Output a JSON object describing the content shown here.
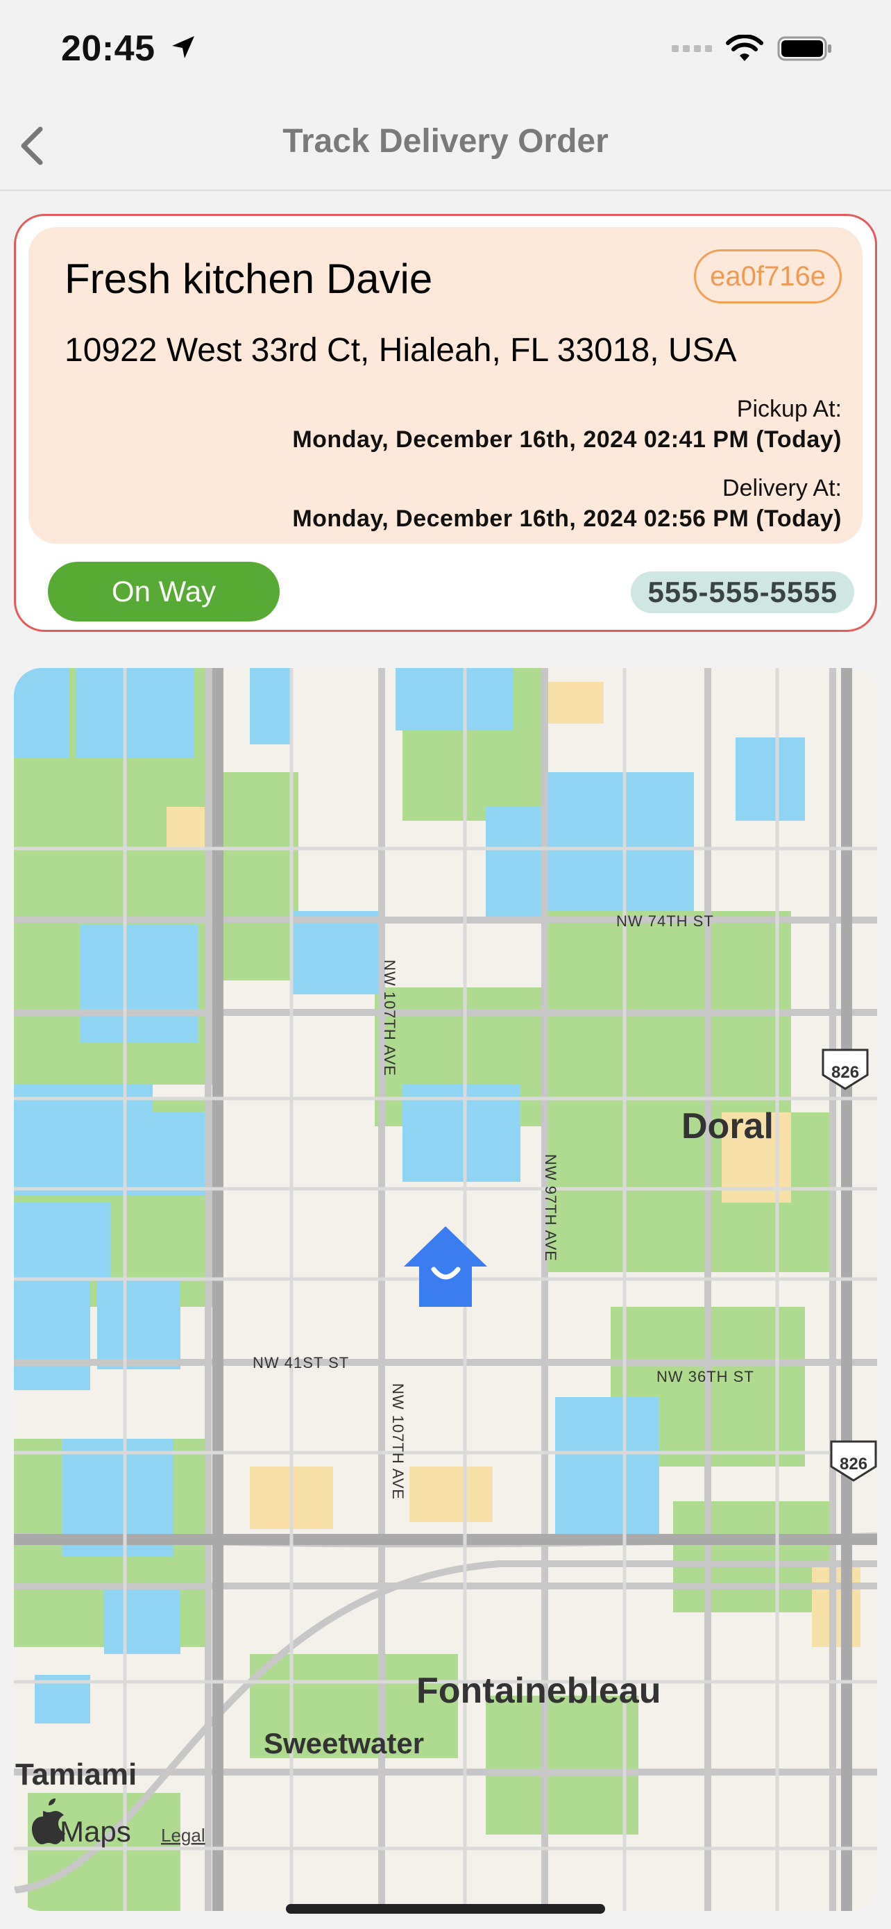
{
  "status_bar": {
    "time": "20:45"
  },
  "nav": {
    "title": "Track Delivery Order"
  },
  "order": {
    "shop_name": "Fresh kitchen Davie",
    "order_id": "ea0f716e",
    "address": "10922 West 33rd Ct, Hialeah, FL 33018, USA",
    "pickup_label": "Pickup At:",
    "pickup_time": "Monday, December 16th, 2024 02:41 PM (Today)",
    "delivery_label": "Delivery At:",
    "delivery_time": "Monday, December 16th, 2024 02:56 PM (Today)",
    "status": "On Way",
    "phone": "555-555-5555"
  },
  "map": {
    "labels": {
      "nw74": "NW 74TH ST",
      "nw107a": "NW 107TH AVE",
      "nw107b": "NW 107TH AVE",
      "nw97": "NW 97TH AVE",
      "nw41": "NW 41ST ST",
      "nw36": "NW 36TH ST",
      "doral": "Doral",
      "fontainebleau": "Fontainebleau",
      "sweetwater": "Sweetwater",
      "tamiami": "Tamiami",
      "hw826a": "826",
      "hw826b": "826",
      "maps": "Maps",
      "legal": "Legal"
    },
    "colors": {
      "water": "#8fd4f2",
      "park": "#a9d98b",
      "road": "#c9c9c9",
      "land": "#f4f1ea"
    }
  }
}
